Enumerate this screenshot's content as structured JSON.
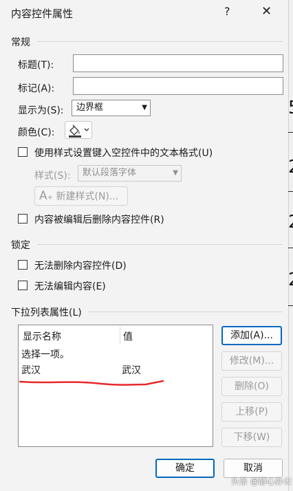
{
  "dialog": {
    "title": "内容控件属性",
    "help": "?",
    "close": "✕"
  },
  "general": {
    "heading": "常规",
    "title_label": "标题(T):",
    "title_value": "",
    "tag_label": "标记(A):",
    "tag_value": "",
    "show_as_label": "显示为(S):",
    "show_as_value": "边界框",
    "color_label": "颜色(C):",
    "use_style_label": "使用样式设置键入空控件中的文本格式(U)",
    "style_label": "样式(S):",
    "style_value": "默认段落字体",
    "new_style_label": "新建样式(N)...",
    "remove_on_edit_label": "内容被编辑后删除内容控件(R)"
  },
  "locking": {
    "heading": "锁定",
    "cannot_delete_label": "无法删除内容控件(D)",
    "cannot_edit_label": "无法编辑内容(E)"
  },
  "dropdown": {
    "heading": "下拉列表属性(L)",
    "columns": [
      "显示名称",
      "值"
    ],
    "rows": [
      {
        "name": "选择一项。",
        "value": ""
      },
      {
        "name": "武汉",
        "value": "武汉"
      }
    ],
    "buttons": {
      "add": "添加(A)...",
      "modify": "修改(M)...",
      "delete": "删除(O)",
      "move_up": "上移(P)",
      "move_down": "下移(W)"
    }
  },
  "footer": {
    "ok": "确定",
    "cancel": "取消"
  },
  "background_fragments": [
    "5",
    "2",
    "2",
    "2"
  ],
  "watermark": "头条 @静心办公",
  "colors": {
    "dialog_bg": "#f3f3f3",
    "primary_border": "#0067c0",
    "annotation_red": "#e8282b"
  }
}
